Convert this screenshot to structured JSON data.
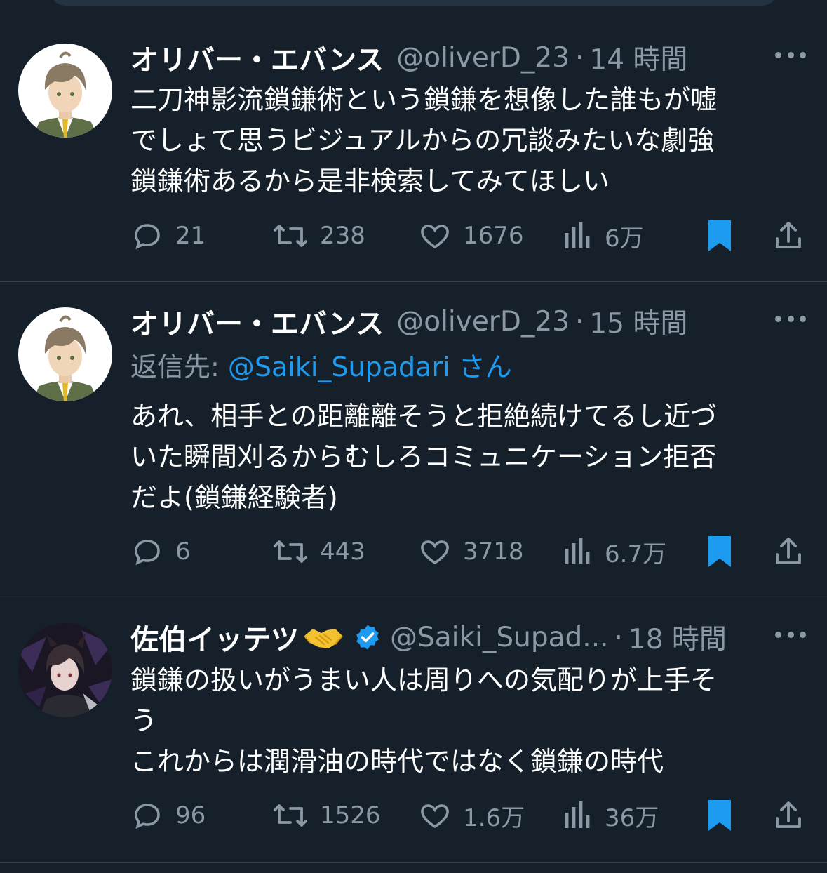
{
  "tweets": [
    {
      "name": "オリバー・エバンス",
      "handle": "@oliverD_23",
      "sep": "·",
      "time": "14 時間",
      "reply_label": "",
      "reply_mention": "",
      "reply_suffix": "",
      "lines": [
        "二刀神影流鎖鎌術という鎖鎌を想像した誰もが嘘",
        "でしょて思うビジュアルからの冗談みたいな劇強",
        "鎖鎌術あるから是非検索してみてほしい"
      ],
      "replies": "21",
      "retweets": "238",
      "likes": "1676",
      "views": "6万",
      "bookmarked": true
    },
    {
      "name": "オリバー・エバンス",
      "handle": "@oliverD_23",
      "sep": "·",
      "time": "15 時間",
      "reply_label": "返信先: ",
      "reply_mention": "@Saiki_Supadari",
      "reply_suffix": " さん",
      "lines": [
        "あれ、相手との距離離そうと拒絶続けてるし近づ",
        "いた瞬間刈るからむしろコミュニケーション拒否",
        "だよ(鎖鎌経験者)"
      ],
      "replies": "6",
      "retweets": "443",
      "likes": "3718",
      "views": "6.7万",
      "bookmarked": true
    },
    {
      "name": "佐伯イッテツ",
      "handle": "@Saiki_Supad...",
      "sep": "·",
      "time": "18 時間",
      "reply_label": "",
      "reply_mention": "",
      "reply_suffix": "",
      "lines": [
        "鎖鎌の扱いがうまい人は周りへの気配りが上手そ",
        "う",
        "これからは潤滑油の時代ではなく鎖鎌の時代"
      ],
      "replies": "96",
      "retweets": "1526",
      "likes": "1.6万",
      "views": "36万",
      "bookmarked": true
    }
  ],
  "icons": {
    "reply": "reply-icon",
    "retweet": "retweet-icon",
    "like": "like-icon",
    "views": "views-icon",
    "bookmark": "bookmark-icon",
    "share": "share-icon",
    "more": "more-icon",
    "verified": "verified-badge-icon",
    "handshake": "handshake-emoji"
  },
  "colors": {
    "background": "#15202b",
    "accent": "#1d9bf0",
    "muted": "#8b98a5",
    "divider": "#38444d"
  }
}
